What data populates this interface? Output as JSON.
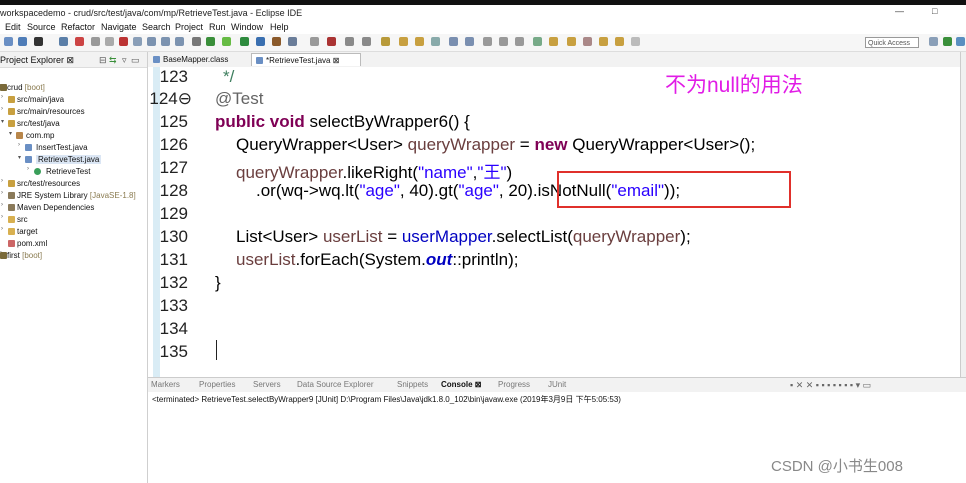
{
  "window": {
    "title": "workspacedemo - crud/src/test/java/com/mp/RetrieveTest.java - Eclipse IDE",
    "minimize": "—",
    "maximize": "□",
    "close": "✕"
  },
  "menu": [
    "Edit",
    "Source",
    "Refactor",
    "Navigate",
    "Search",
    "Project",
    "Run",
    "Window",
    "Help"
  ],
  "toolbar": {
    "quick_access": "Quick Access"
  },
  "explorer": {
    "title": "Project Explorer ⊠",
    "rows": [
      {
        "label": "crud",
        "decoration": " [boot]"
      },
      {
        "label": "src/main/java",
        "decoration": ""
      },
      {
        "label": "src/main/resources",
        "decoration": ""
      },
      {
        "label": "src/test/java",
        "decoration": ""
      },
      {
        "label": "com.mp",
        "decoration": ""
      },
      {
        "label": "InsertTest.java",
        "decoration": ""
      },
      {
        "label": "RetrieveTest.java",
        "decoration": ""
      },
      {
        "label": "RetrieveTest",
        "decoration": ""
      },
      {
        "label": "src/test/resources",
        "decoration": ""
      },
      {
        "label": "JRE System Library",
        "decoration": " [JavaSE-1.8]"
      },
      {
        "label": "Maven Dependencies",
        "decoration": ""
      },
      {
        "label": "src",
        "decoration": ""
      },
      {
        "label": "target",
        "decoration": ""
      },
      {
        "label": "pom.xml",
        "decoration": ""
      },
      {
        "label": "first",
        "decoration": " [boot]"
      }
    ]
  },
  "editor": {
    "tabs": [
      "BaseMapper.class",
      "*RetrieveTest.java ⊠"
    ],
    "annotation": "不为null的用法",
    "line_numbers": [
      "123",
      "124⊖",
      "125",
      "126",
      "127",
      "128",
      "129",
      "130",
      "131",
      "132",
      "133",
      "134",
      "135"
    ],
    "code": {
      "l123": "*/",
      "l124": "@Test",
      "l125_kw": "public void",
      "l125_rest": " selectByWrapper6() {",
      "l126_a": "QueryWrapper<User> ",
      "l126_var": "queryWrapper",
      "l126_b": " = ",
      "l126_kw": "new",
      "l126_c": " QueryWrapper<User>();",
      "l127_var": "queryWrapper",
      "l127_a": ".likeRight(",
      "l127_s1": "\"name\"",
      "l127_b": ",",
      "l127_s2": "\"王\"",
      "l127_c": ")",
      "l128_a": ".or(wq->wq.lt(",
      "l128_s1": "\"age\"",
      "l128_b": ", 40).gt(",
      "l128_s2": "\"age\"",
      "l128_c": ", 20).isNotNull(",
      "l128_s3": "\"email\"",
      "l128_d": "));",
      "l130_a": "List<User> ",
      "l130_var": "userList",
      "l130_b": " = ",
      "l130_fld": "userMapper",
      "l130_c": ".selectList(",
      "l130_var2": "queryWrapper",
      "l130_d": ");",
      "l131_var": "userList",
      "l131_a": ".forEach(System.",
      "l131_sfld": "out",
      "l131_b": "::println);",
      "l132": "}"
    }
  },
  "console": {
    "tabs": [
      "Markers",
      "Properties",
      "Servers",
      "Data Source Explorer",
      "Snippets",
      "Console ⊠",
      "Progress",
      "JUnit"
    ],
    "status": "<terminated> RetrieveTest.selectByWrapper9 [JUnit] D:\\Program Files\\Java\\jdk1.8.0_102\\bin\\javaw.exe (2019年3月9日 下午5:05:53)"
  },
  "watermark": "CSDN @小书生008",
  "colors": {
    "annotation": "#e11ce6",
    "highlight_box": "#e0302b",
    "gutter": "#d9ecf5",
    "keyword": "#7f0055",
    "string": "#2a00ff",
    "field": "#0000c0"
  }
}
